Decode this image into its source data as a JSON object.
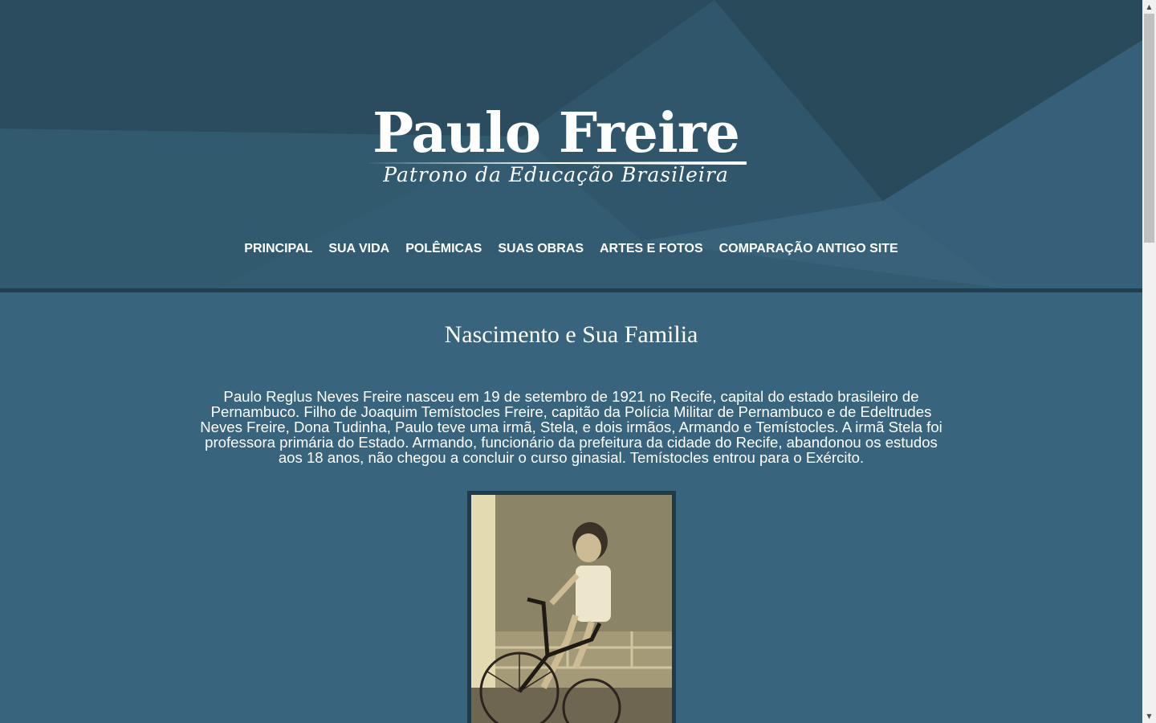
{
  "logo": {
    "title": "Paulo Freire",
    "subtitle": "Patrono da Educação Brasileira"
  },
  "nav": {
    "items": [
      {
        "label": "PRINCIPAL"
      },
      {
        "label": "SUA VIDA"
      },
      {
        "label": "POLÊMICAS"
      },
      {
        "label": "SUAS OBRAS"
      },
      {
        "label": "ARTES E FOTOS"
      },
      {
        "label": "COMPARAÇÃO ANTIGO SITE"
      }
    ]
  },
  "main": {
    "heading": "Nascimento e Sua Familia",
    "paragraph": "Paulo Reglus Neves Freire nasceu em 19 de setembro de 1921 no Recife, capital do estado brasileiro de Pernambuco. Filho de Joaquim Temístocles Freire, capitão da Polícia Militar de Pernambuco e de Edeltrudes Neves Freire, Dona Tudinha, Paulo teve uma irmã, Stela, e dois irmãos, Armando e Temístocles. A irmã Stela foi professora primária do Estado. Armando, funcionário da prefeitura da cidade do Recife, abandonou os estudos aos 18 anos, não chegou a concluir o curso ginasial. Temístocles entrou para o Exército."
  },
  "colors": {
    "header_bg": "#2e5366",
    "content_bg": "#38647d",
    "text": "#ffffff"
  }
}
